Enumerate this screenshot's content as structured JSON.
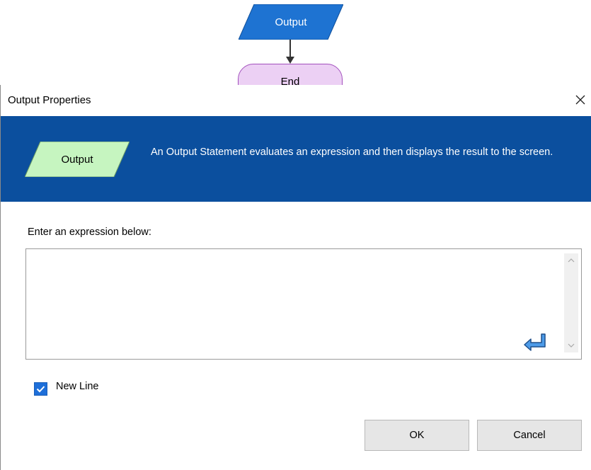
{
  "flowchart": {
    "output_shape_label": "Output",
    "end_shape_label": "End"
  },
  "dialog": {
    "title": "Output Properties",
    "banner": {
      "shape_label": "Output",
      "description": "An Output Statement evaluates an expression and then displays the result to the screen."
    },
    "expression": {
      "label": "Enter an expression below:",
      "value": ""
    },
    "new_line": {
      "label": "New Line",
      "checked": true
    },
    "buttons": {
      "ok": "OK",
      "cancel": "Cancel"
    }
  },
  "colors": {
    "banner_bg": "#0b4f9e",
    "output_shape_fill": "#1e73d2",
    "banner_shape_fill": "#c6f5c0",
    "end_shape_fill": "#ecd0f4",
    "checkbox_fill": "#1e6fd9"
  },
  "icons": {
    "close": "close-icon",
    "enter": "enter-key-icon",
    "check": "checkmark-icon",
    "scroll_up": "chevron-up-icon",
    "scroll_down": "chevron-down-icon"
  }
}
